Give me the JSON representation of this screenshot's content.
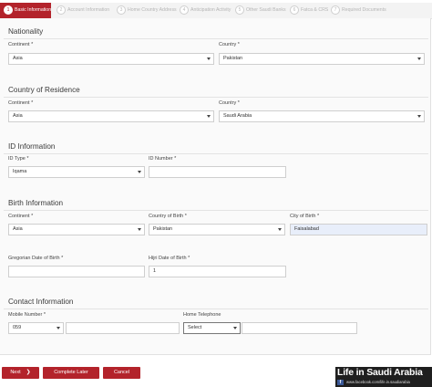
{
  "steps": [
    {
      "num": "1",
      "label": "Basic Information"
    },
    {
      "num": "2",
      "label": "Account Information"
    },
    {
      "num": "3",
      "label": "Home Country Address"
    },
    {
      "num": "4",
      "label": "Anticipation Activity"
    },
    {
      "num": "5",
      "label": "Other Saudi Banks"
    },
    {
      "num": "6",
      "label": "Fatca & CRS"
    },
    {
      "num": "7",
      "label": "Required Documents"
    }
  ],
  "nationality": {
    "title": "Nationality",
    "continent_label": "Continent",
    "continent_value": "Asia",
    "country_label": "Country",
    "country_value": "Pakistan"
  },
  "residence": {
    "title": "Country of Residence",
    "continent_label": "Continent",
    "continent_value": "Asia",
    "country_label": "Country",
    "country_value": "Saudi Arabia"
  },
  "id_info": {
    "title": "ID Information",
    "type_label": "ID Type",
    "type_value": "Iqama",
    "number_label": "ID Number",
    "number_value": ""
  },
  "birth": {
    "title": "Birth Information",
    "continent_label": "Continent",
    "continent_value": "Asia",
    "country_label": "Country of Birth",
    "country_value": "Pakistan",
    "city_label": "City of Birth",
    "city_value": "Faisalabad",
    "greg_label": "Gregorian Date of Birth",
    "greg_value": "",
    "hijri_label": "Hijri Date of Birth",
    "hijri_value": "1"
  },
  "contact": {
    "title": "Contact Information",
    "mobile_label": "Mobile Number",
    "mobile_code": "059",
    "mobile_value": "",
    "home_label": "Home Telephone",
    "home_code": "Select",
    "home_value": ""
  },
  "required_mark": "*",
  "buttons": {
    "next": "Next",
    "next_arrow": "❯",
    "complete_later": "Complete Later",
    "cancel": "Cancel"
  },
  "brand": {
    "title": "Life in Saudi Arabia",
    "fb": "f",
    "sub": "www.facebook.com/life.in.saudiarabia"
  },
  "colors": {
    "accent": "#b3232b",
    "highlight_field": "#e8eefa"
  }
}
